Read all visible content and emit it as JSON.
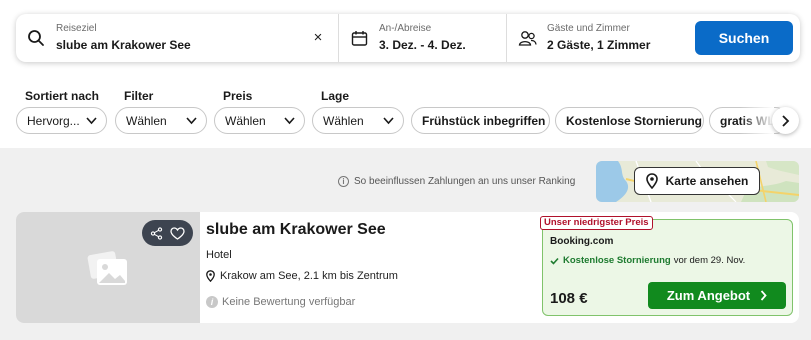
{
  "search": {
    "destination_label": "Reiseziel",
    "destination_value": "slube am Krakower See",
    "clear_symbol": "×",
    "dates_label": "An-/Abreise",
    "dates_value": "3. Dez. - 4. Dez.",
    "guests_label": "Gäste und Zimmer",
    "guests_value": "2 Gäste, 1 Zimmer",
    "submit_label": "Suchen",
    "icons": [
      "search-icon",
      "calendar-icon",
      "guests-icon",
      "clear-icon"
    ],
    "accent_color": "#0a6bc8"
  },
  "filters": {
    "labels": {
      "sort": "Sortiert nach",
      "filter": "Filter",
      "price": "Preis",
      "location": "Lage"
    },
    "chips": {
      "sort": "Hervorg...",
      "filter": "Wählen",
      "price": "Wählen",
      "location": "Wählen",
      "breakfast": "Frühstück inbegriffen",
      "cancellation": "Kostenlose Stornierung",
      "wlan": "gratis WLAN"
    }
  },
  "results": {
    "ranking_note": "So beeinflussen Zahlungen an uns unser Ranking",
    "map_button": "Karte ansehen",
    "hotel": {
      "name": "slube am Krakower See",
      "type": "Hotel",
      "location": "Krakow am See, 2.1 km bis Zentrum",
      "rating": "Keine Bewertung verfügbar",
      "deal": {
        "badge": "Unser niedrigster Preis",
        "provider": "Booking.com",
        "cancellation_bold": "Kostenlose Stornierung",
        "cancellation_rest": "vor dem 29. Nov.",
        "price": "108 €",
        "button": "Zum Angebot",
        "button_color": "#118a1e"
      }
    }
  }
}
